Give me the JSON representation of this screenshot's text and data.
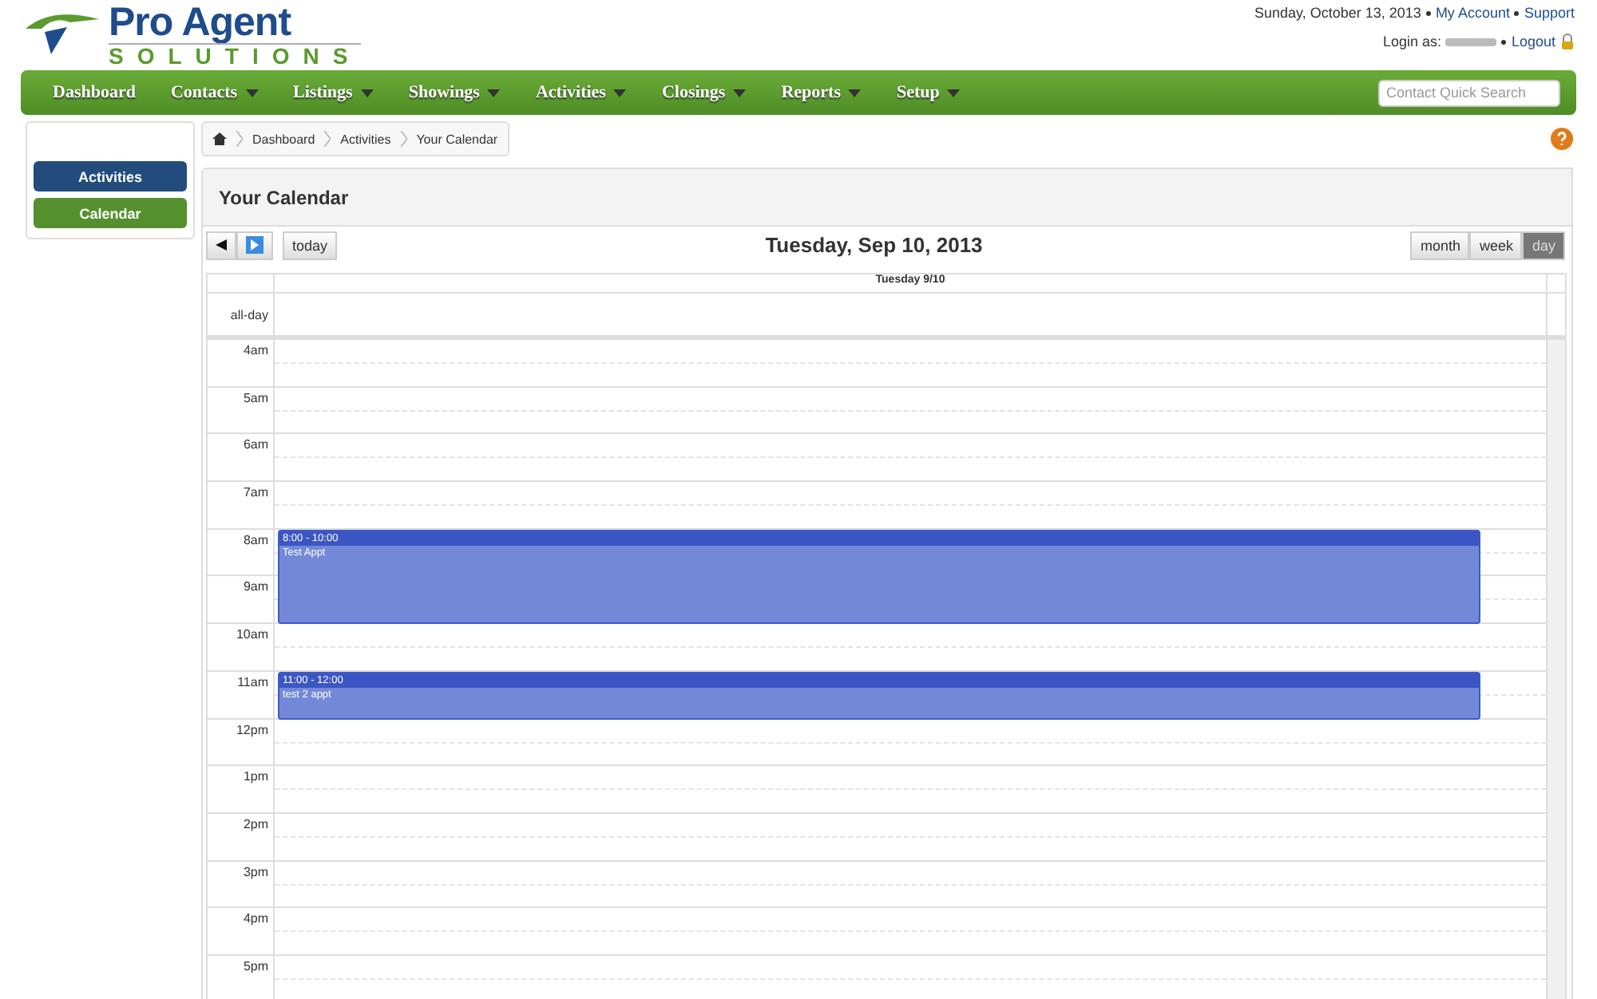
{
  "header": {
    "brand_top": "Pro Agent",
    "brand_bottom": "SOLUTIONS",
    "date": "Sunday, October 13, 2013",
    "links": [
      "My Account",
      "Support"
    ],
    "login_label": "Login as:",
    "logout": "Logout"
  },
  "nav": {
    "items": [
      {
        "label": "Dashboard",
        "dropdown": false
      },
      {
        "label": "Contacts",
        "dropdown": true
      },
      {
        "label": "Listings",
        "dropdown": true
      },
      {
        "label": "Showings",
        "dropdown": true
      },
      {
        "label": "Activities",
        "dropdown": true
      },
      {
        "label": "Closings",
        "dropdown": true
      },
      {
        "label": "Reports",
        "dropdown": true
      },
      {
        "label": "Setup",
        "dropdown": true
      }
    ],
    "search": {
      "placeholder": "Contact Quick Search"
    }
  },
  "sidebar": {
    "items": [
      {
        "label": "Activities",
        "selected": false
      },
      {
        "label": "Calendar",
        "selected": true
      }
    ]
  },
  "breadcrumb": [
    "Dashboard",
    "Activities",
    "Your Calendar"
  ],
  "panel": {
    "title": "Your Calendar"
  },
  "calendar": {
    "title": "Tuesday, Sep 10, 2013",
    "today": "today",
    "views": [
      {
        "label": "month",
        "selected": false
      },
      {
        "label": "week",
        "selected": false
      },
      {
        "label": "day",
        "selected": true
      }
    ],
    "column": "Tuesday 9/10",
    "allday": "all-day",
    "hours": [
      "4am",
      "5am",
      "6am",
      "7am",
      "8am",
      "9am",
      "10am",
      "11am",
      "12pm",
      "1pm",
      "2pm",
      "3pm",
      "4pm",
      "5pm"
    ],
    "events": [
      {
        "time": "8:00 - 10:00",
        "title": "Test Appt"
      },
      {
        "time": "11:00 - 12:00",
        "title": "test 2 appt"
      }
    ]
  }
}
